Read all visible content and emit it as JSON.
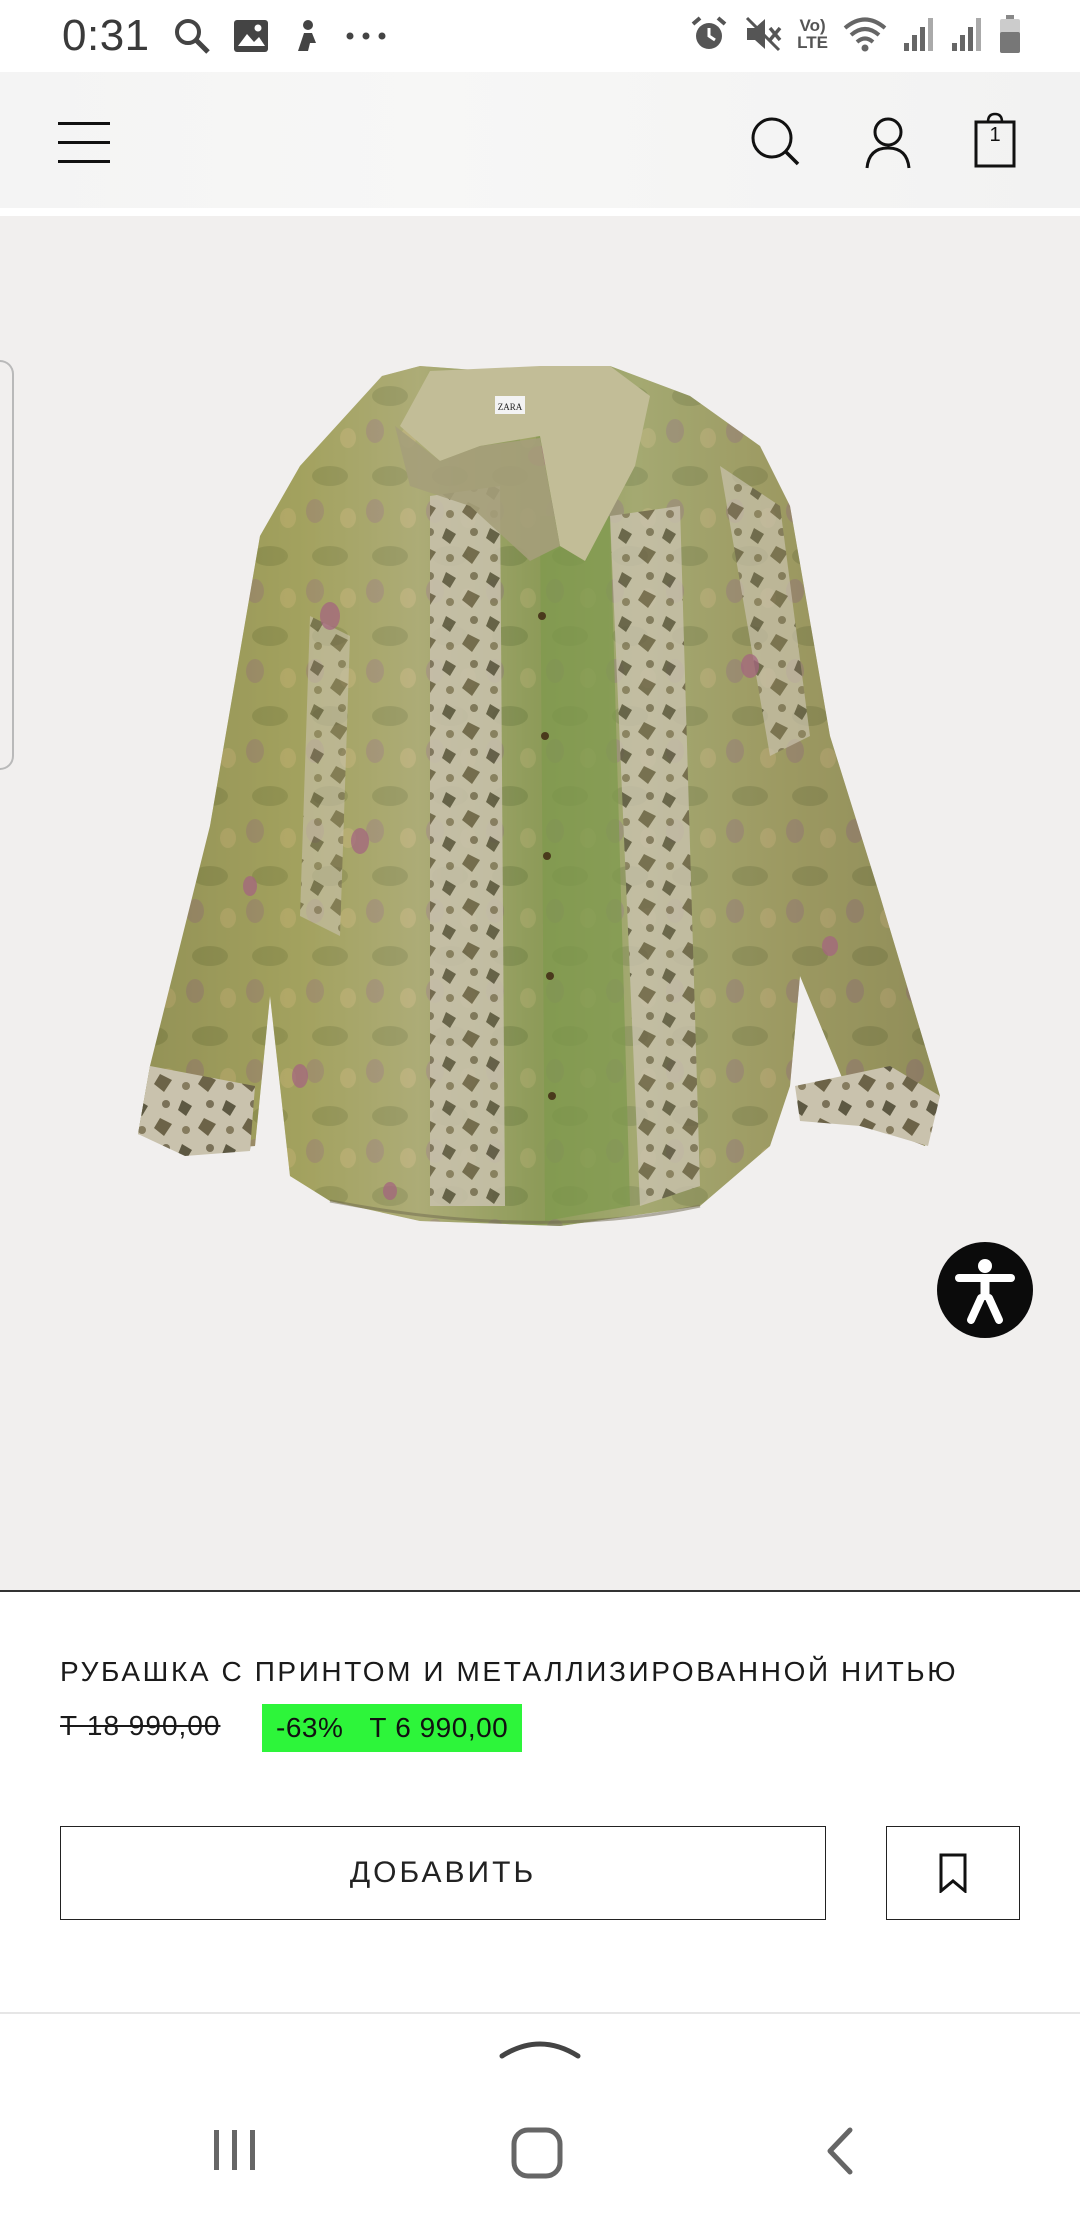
{
  "status_bar": {
    "time": "0:31",
    "network_label_top": "Vo)",
    "network_label_bottom": "LTE"
  },
  "header": {
    "bag_count": "1"
  },
  "product": {
    "title": "РУБАШКА С ПРИНТОМ И МЕТАЛЛИЗИРОВАННОЙ НИТЬЮ",
    "old_price": "Т 18 990,00",
    "discount": "-63%",
    "new_price": "Т 6 990,00",
    "discount_color": "#2df53a",
    "image_label": "ZARA"
  },
  "actions": {
    "add_label": "ДОБАВИТЬ"
  },
  "icons": {
    "status": [
      "search-icon",
      "image-icon",
      "notification-icon",
      "more-icon",
      "alarm-icon",
      "mute-icon",
      "wifi-icon",
      "signal-icon",
      "signal-icon",
      "battery-icon"
    ],
    "header": [
      "menu-icon",
      "search-icon",
      "account-icon",
      "bag-icon"
    ],
    "nav": [
      "recents-icon",
      "home-icon",
      "back-icon"
    ]
  }
}
